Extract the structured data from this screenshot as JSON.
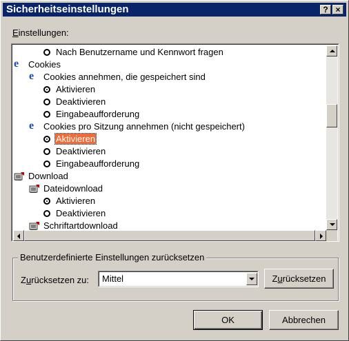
{
  "window": {
    "title": "Sicherheitseinstellungen",
    "help_button": "?",
    "close_button": "×"
  },
  "settings_label": {
    "underlined": "E",
    "rest": "instellungen:"
  },
  "tree": {
    "rows": [
      {
        "type": "radio",
        "label": "Nach Benutzername und Kennwort fragen",
        "selected": false
      },
      {
        "type": "category",
        "icon": "ie-icon",
        "label": "Cookies"
      },
      {
        "type": "subcategory",
        "icon": "ie-icon",
        "label": "Cookies annehmen, die gespeichert sind"
      },
      {
        "type": "radio",
        "label": "Aktivieren",
        "selected": true
      },
      {
        "type": "radio",
        "label": "Deaktivieren",
        "selected": false
      },
      {
        "type": "radio",
        "label": "Eingabeaufforderung",
        "selected": false
      },
      {
        "type": "subcategory",
        "icon": "ie-icon",
        "label": "Cookies pro Sitzung annehmen (nicht gespeichert)"
      },
      {
        "type": "radio",
        "label": "Aktivieren",
        "selected": true,
        "highlighted": true
      },
      {
        "type": "radio",
        "label": "Deaktivieren",
        "selected": false
      },
      {
        "type": "radio",
        "label": "Eingabeaufforderung",
        "selected": false
      },
      {
        "type": "category",
        "icon": "download-icon",
        "label": "Download"
      },
      {
        "type": "subcategory",
        "icon": "download-icon",
        "label": "Dateidownload"
      },
      {
        "type": "radio",
        "label": "Aktivieren",
        "selected": true
      },
      {
        "type": "radio",
        "label": "Deaktivieren",
        "selected": false
      },
      {
        "type": "subcategory",
        "icon": "download-icon",
        "label": "Schriftartdownload"
      }
    ]
  },
  "reset_group": {
    "title": "Benutzerdefinierte Einstellungen zurücksetzen",
    "reset_to_label": {
      "pre": "Z",
      "underlined": "u",
      "rest": "rücksetzen zu:"
    },
    "combo_value": "Mittel",
    "reset_button": {
      "pre": "Z",
      "underlined": "u",
      "rest": "rücksetzen"
    }
  },
  "buttons": {
    "ok": "OK",
    "cancel": "Abbrechen"
  },
  "colors": {
    "title_bar": "#0a246a",
    "selection": "#f26b37",
    "face": "#d4d0c8"
  }
}
